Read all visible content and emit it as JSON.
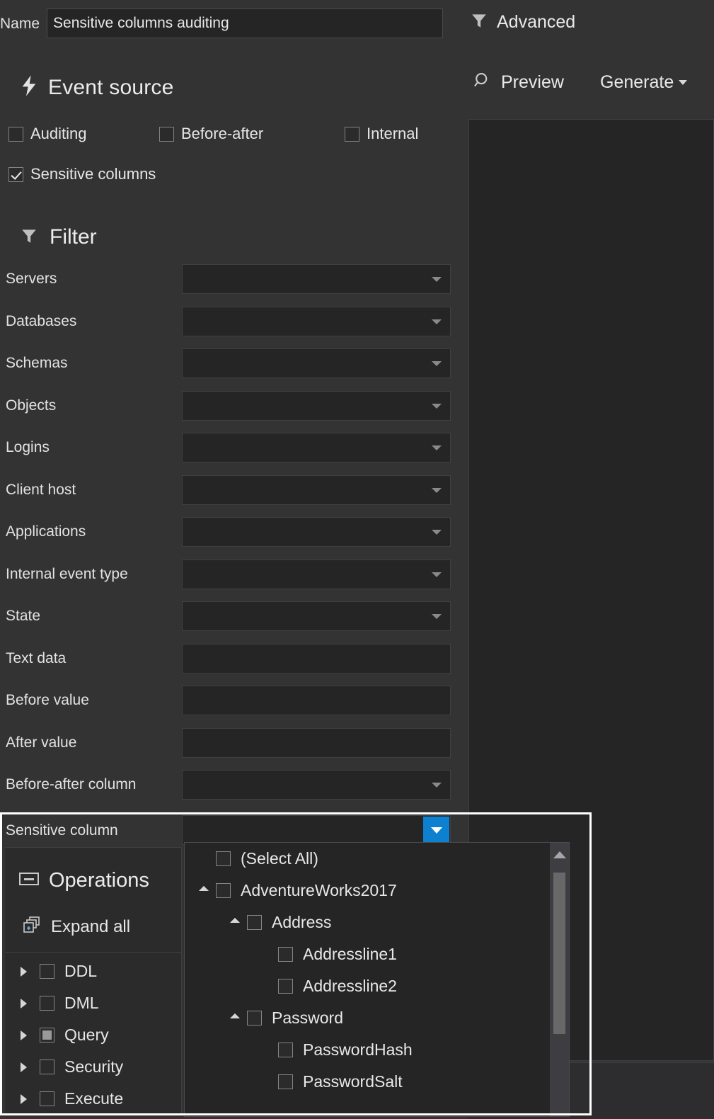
{
  "header": {
    "name_label": "Name",
    "name_value": "Sensitive columns auditing",
    "name_placeholder": "",
    "advanced_label": "Advanced",
    "preview_label": "Preview",
    "generate_label": "Generate"
  },
  "event_source": {
    "title": "Event source",
    "options": [
      {
        "label": "Auditing",
        "checked": false
      },
      {
        "label": "Before-after",
        "checked": false
      },
      {
        "label": "Internal",
        "checked": false
      },
      {
        "label": "Sensitive columns",
        "checked": true
      }
    ]
  },
  "filter": {
    "title": "Filter",
    "rows": [
      {
        "label": "Servers",
        "type": "combo",
        "value": ""
      },
      {
        "label": "Databases",
        "type": "combo",
        "value": ""
      },
      {
        "label": "Schemas",
        "type": "combo",
        "value": ""
      },
      {
        "label": "Objects",
        "type": "combo",
        "value": ""
      },
      {
        "label": "Logins",
        "type": "combo",
        "value": ""
      },
      {
        "label": "Client host",
        "type": "combo",
        "value": ""
      },
      {
        "label": "Applications",
        "type": "combo",
        "value": ""
      },
      {
        "label": "Internal event type",
        "type": "combo",
        "value": ""
      },
      {
        "label": "State",
        "type": "combo",
        "value": ""
      },
      {
        "label": "Text data",
        "type": "text",
        "value": ""
      },
      {
        "label": "Before value",
        "type": "text",
        "value": ""
      },
      {
        "label": "After value",
        "type": "text",
        "value": ""
      },
      {
        "label": "Before-after column",
        "type": "combo",
        "value": ""
      }
    ],
    "sensitive_column": {
      "label": "Sensitive column",
      "value": ""
    }
  },
  "operations": {
    "title": "Operations",
    "expand_all_label": "Expand all",
    "items": [
      {
        "label": "DDL",
        "state": "unchecked"
      },
      {
        "label": "DML",
        "state": "unchecked"
      },
      {
        "label": "Query",
        "state": "partial"
      },
      {
        "label": "Security",
        "state": "unchecked"
      },
      {
        "label": "Execute",
        "state": "unchecked"
      }
    ]
  },
  "sensitive_column_tree": {
    "items": [
      {
        "label": "(Select All)",
        "indent": 0,
        "expander": "none",
        "checked": false
      },
      {
        "label": "AdventureWorks2017",
        "indent": 0,
        "expander": "expanded",
        "checked": false
      },
      {
        "label": "Address",
        "indent": 1,
        "expander": "expanded",
        "checked": false
      },
      {
        "label": "Addressline1",
        "indent": 2,
        "expander": "none",
        "checked": false
      },
      {
        "label": "Addressline2",
        "indent": 2,
        "expander": "none",
        "checked": false
      },
      {
        "label": "Password",
        "indent": 1,
        "expander": "expanded",
        "checked": false
      },
      {
        "label": "PasswordHash",
        "indent": 2,
        "expander": "none",
        "checked": false
      },
      {
        "label": "PasswordSalt",
        "indent": 2,
        "expander": "none",
        "checked": false
      }
    ],
    "scrollbar": {
      "position": "right"
    }
  },
  "colors": {
    "background": "#333333",
    "field": "#252526",
    "accent": "#0d81d0",
    "highlight": "#ffffff",
    "text": "#e6e6e6"
  }
}
